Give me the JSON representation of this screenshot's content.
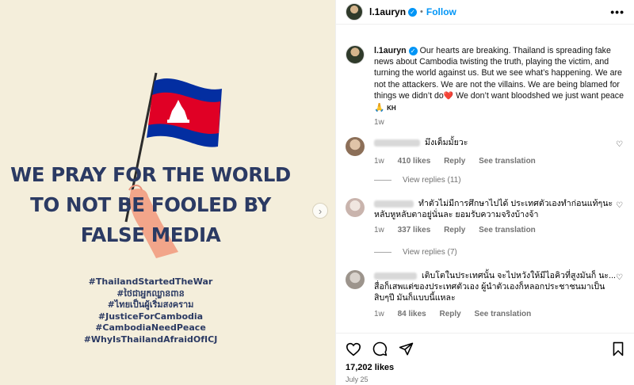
{
  "post_image": {
    "headline_lines": [
      "WE PRAY FOR THE WORLD",
      "TO NOT BE FOOLED BY",
      "FALSE MEDIA"
    ],
    "hashtags": [
      "#ThailandStartedTheWar",
      "#ថៃជាអ្នកឈ្លានពាន",
      "#ไทยเป็นผู้เริ่มสงคราม",
      "#JusticeForCambodia",
      "#CambodiaNeedPeace",
      "#WhyIsThailandAfraidOfICJ"
    ],
    "next_arrow": "›"
  },
  "header": {
    "username": "l.1auryn",
    "separator": "•",
    "follow_label": "Follow",
    "more_label": "•••"
  },
  "caption": {
    "username": "l.1auryn",
    "text": " Our hearts are breaking. Thailand is spreading fake news about Cambodia twisting the truth, playing the victim, and turning the world against us. But we see what’s happening. We are not the attackers. We are not the villains. We are being blamed for things we didn’t do",
    "heart_emoji": "❤️",
    "text_end": " We don’t want bloodshed we just want peace🙏 ",
    "flag_code": "KH",
    "time": "1w"
  },
  "comments": [
    {
      "text": "มึงเต็มมั้ยวะ",
      "time": "1w",
      "likes": "410 likes",
      "reply": "Reply",
      "translate": "See translation",
      "view_replies": "View replies (11)"
    },
    {
      "text": "ทำตัวไม่มีการศึกษาไปได้ ประเทศตัวเองทำก่อนแท้ๆนะ หลับหูหลับตาอยู่นั่นละ ยอมรับความจริงบ้างจ้า",
      "time": "1w",
      "likes": "337 likes",
      "reply": "Reply",
      "translate": "See translation",
      "view_replies": "View replies (7)"
    },
    {
      "text": "เติบโตในประเทศนั้น จะไปหวังให้มีไอคิวที่สูงมันก็ นะ... สื่อก็เสพแต่ของประเทศตัวเอง ผู้นำตัวเองก็หลอกประชาชนมาเป็นสิบๆปี มันก็แบบนี้แหละ",
      "time": "1w",
      "likes": "84 likes",
      "reply": "Reply",
      "translate": "See translation"
    }
  ],
  "footer": {
    "likes": "17,202 likes",
    "date": "July 25"
  },
  "colors": {
    "accent": "#0095f6",
    "headline": "#2b3a63",
    "image_bg": "#f4eedb",
    "flag_blue": "#032ea1",
    "flag_red": "#e00025"
  }
}
